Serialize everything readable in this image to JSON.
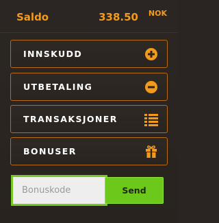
{
  "header": {
    "label": "Saldo",
    "amount": "338.50",
    "currency": "NOK"
  },
  "menu": {
    "items": [
      {
        "label": "INNSKUDD",
        "icon": "plus-circle-icon"
      },
      {
        "label": "UTBETALING",
        "icon": "minus-circle-icon"
      },
      {
        "label": "TRANSAKSJONER",
        "icon": "list-icon"
      },
      {
        "label": "BONUSER",
        "icon": "gift-icon"
      }
    ]
  },
  "bonus": {
    "placeholder": "Bonuskode",
    "value": "",
    "send_label": "Send"
  },
  "colors": {
    "accent": "#f39a1c",
    "border": "#b86a14",
    "background": "#2a2522",
    "button": "#6dc81c",
    "input_border": "#77c825"
  }
}
